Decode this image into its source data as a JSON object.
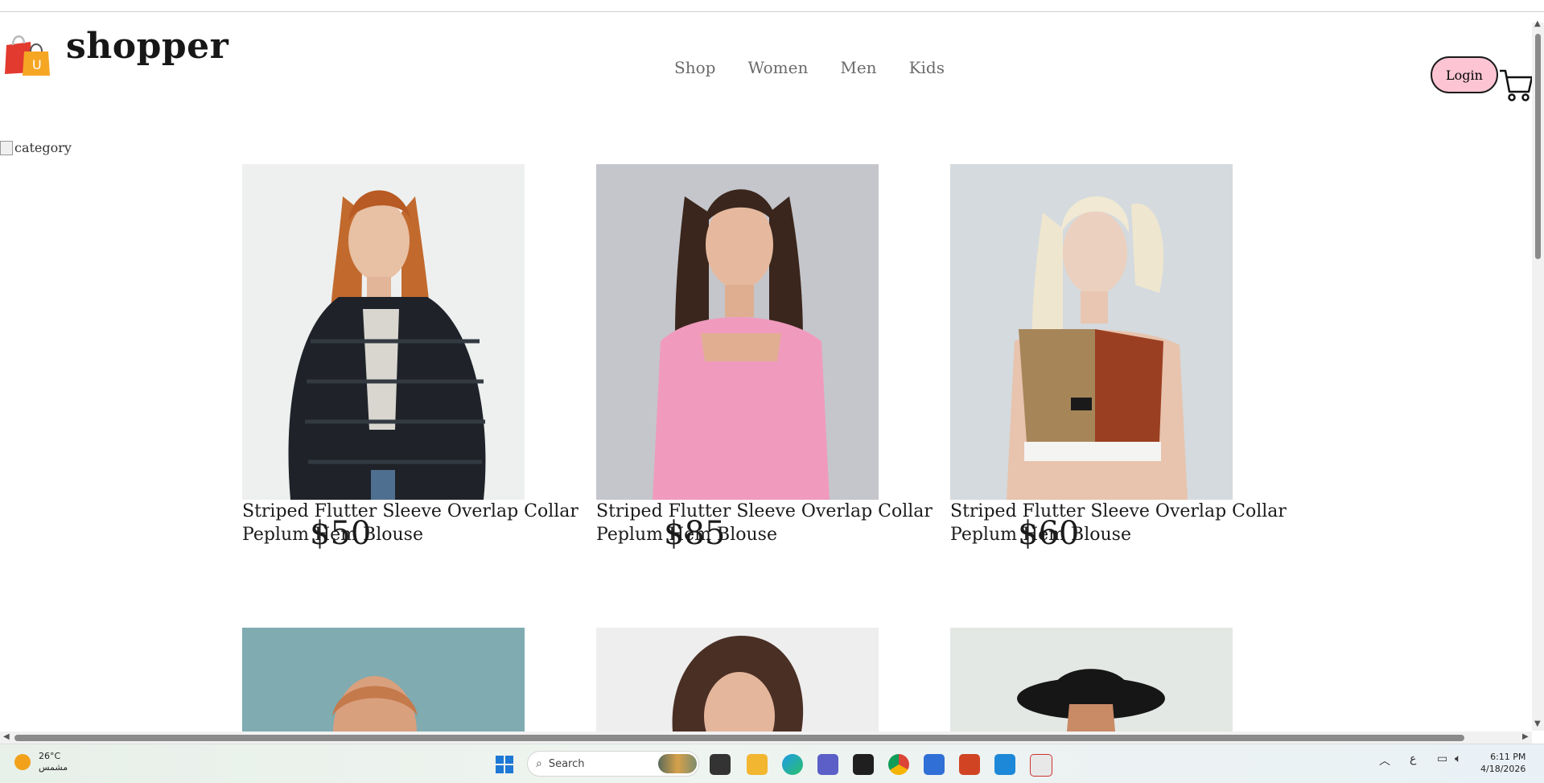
{
  "header": {
    "logo_text": "shopper",
    "logo_letter": "U",
    "nav": [
      "Shop",
      "Women",
      "Men",
      "Kids"
    ],
    "login_label": "Login"
  },
  "banner": {
    "alt": "category"
  },
  "products_row1": [
    {
      "name": "Striped Flutter Sleeve Overlap Collar Peplum Hem Blouse",
      "price": "$50"
    },
    {
      "name": "Striped Flutter Sleeve Overlap Collar Peplum Hem Blouse",
      "price": "$85"
    },
    {
      "name": "Striped Flutter Sleeve Overlap Collar Peplum Hem Blouse",
      "price": "$60"
    }
  ],
  "taskbar": {
    "weather_temp": "26°C",
    "weather_desc": "مشمس",
    "search_placeholder": "Search",
    "time": "6:11 PM",
    "date": "4/18/2026",
    "lang": "ع"
  },
  "colors": {
    "login_bg": "#fdc5d4",
    "nav_text": "#6b6b6b",
    "win_blue": "#1e78d6"
  }
}
